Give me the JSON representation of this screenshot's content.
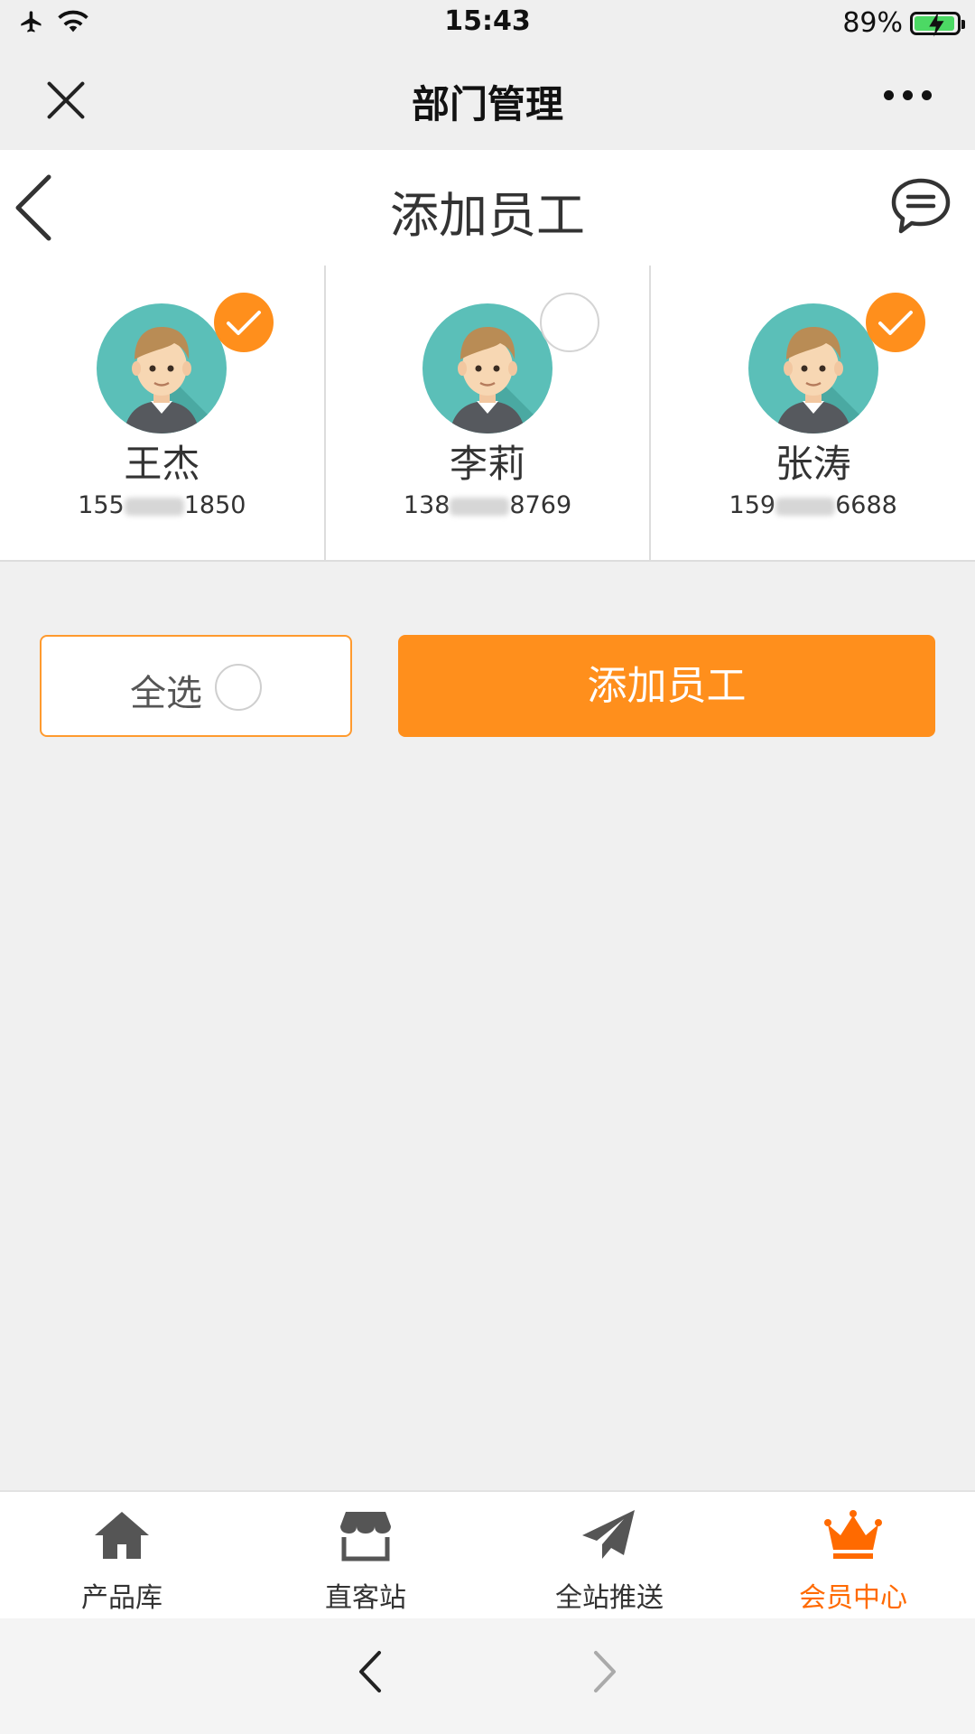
{
  "status_bar": {
    "time": "15:43",
    "battery_percent": "89%",
    "icons": [
      "airplane-icon",
      "wifi-icon",
      "battery-icon"
    ]
  },
  "wechat_bar": {
    "title": "部门管理",
    "close_icon": "close-icon",
    "more_icon": "more-icon"
  },
  "nav": {
    "title": "添加员工",
    "back_icon": "back-arrow-icon",
    "chat_icon": "chat-bubble-icon"
  },
  "staff": [
    {
      "name": "王杰",
      "phone_prefix": "155",
      "phone_suffix": "1850",
      "selected": true
    },
    {
      "name": "李莉",
      "phone_prefix": "138",
      "phone_suffix": "8769",
      "selected": false
    },
    {
      "name": "张涛",
      "phone_prefix": "159",
      "phone_suffix": "6688",
      "selected": true
    }
  ],
  "actions": {
    "select_all_label": "全选",
    "select_all_checked": false,
    "add_label": "添加员工"
  },
  "tabbar": {
    "items": [
      {
        "label": "产品库",
        "icon": "home-icon",
        "active": false
      },
      {
        "label": "直客站",
        "icon": "store-icon",
        "active": false
      },
      {
        "label": "全站推送",
        "icon": "paper-plane-icon",
        "active": false
      },
      {
        "label": "会员中心",
        "icon": "crown-icon",
        "active": true
      }
    ]
  },
  "browser_bar": {
    "back_icon": "chevron-left-icon",
    "forward_icon": "chevron-right-icon"
  },
  "colors": {
    "accent": "#ff8f1c",
    "active_tab": "#ff6a00",
    "avatar_bg": "#5bbfb8"
  }
}
